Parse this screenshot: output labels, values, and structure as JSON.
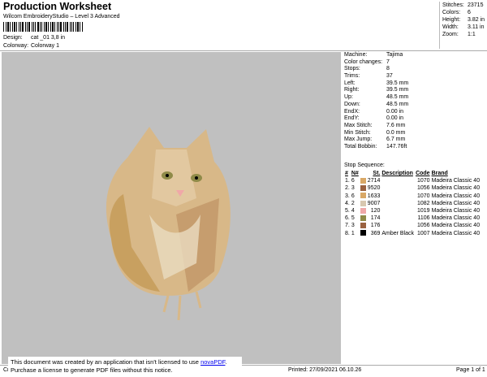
{
  "header": {
    "title": "Production Worksheet",
    "subtitle": "Wilcom EmbroideryStudio – Level 3 Advanced",
    "design_label": "Design:",
    "design_value": "cat _01 3,8 in",
    "colorway_label": "Colorway:",
    "colorway_value": "Colorway 1"
  },
  "stats": [
    {
      "k": "Stitches:",
      "v": "23715"
    },
    {
      "k": "Colors:",
      "v": "6"
    },
    {
      "k": "Height:",
      "v": "3.82 in"
    },
    {
      "k": "Width:",
      "v": "3.11 in"
    },
    {
      "k": "Zoom:",
      "v": "1:1"
    }
  ],
  "info": [
    {
      "k": "Machine:",
      "v": "Tajima"
    },
    {
      "k": "Color changes:",
      "v": "7"
    },
    {
      "k": "Stops:",
      "v": "8"
    },
    {
      "k": "Trims:",
      "v": "37"
    },
    {
      "k": "Left:",
      "v": "39.5 mm"
    },
    {
      "k": "Right:",
      "v": "39.5 mm"
    },
    {
      "k": "Up:",
      "v": "48.5 mm"
    },
    {
      "k": "Down:",
      "v": "48.5 mm"
    },
    {
      "k": "EndX:",
      "v": "0.00 in"
    },
    {
      "k": "EndY:",
      "v": "0.00 in"
    },
    {
      "k": "Max Stitch:",
      "v": "7.6 mm"
    },
    {
      "k": "Min Stitch:",
      "v": "0.0 mm"
    },
    {
      "k": "Max Jump:",
      "v": "6.7 mm"
    },
    {
      "k": "Total Bobbin:",
      "v": "147.76ft"
    }
  ],
  "sequence": {
    "title": "Stop Sequence:",
    "headers": [
      "#",
      "N#",
      "St.",
      "Description",
      "Code",
      "Brand"
    ],
    "rows": [
      {
        "i": "1.",
        "n": "6",
        "color": "#d9a866",
        "st": "2714",
        "desc": "",
        "code": "1070",
        "brand": "Madeira Classic 40"
      },
      {
        "i": "2.",
        "n": "3",
        "color": "#9a6240",
        "st": "9520",
        "desc": "",
        "code": "1056",
        "brand": "Madeira Classic 40"
      },
      {
        "i": "3.",
        "n": "6",
        "color": "#d9a866",
        "st": "1633",
        "desc": "",
        "code": "1070",
        "brand": "Madeira Classic 40"
      },
      {
        "i": "4.",
        "n": "2",
        "color": "#d8c8b0",
        "st": "9007",
        "desc": "",
        "code": "1082",
        "brand": "Madeira Classic 40"
      },
      {
        "i": "5.",
        "n": "4",
        "color": "#f0a8a8",
        "st": "120",
        "desc": "",
        "code": "1019",
        "brand": "Madeira Classic 40"
      },
      {
        "i": "6.",
        "n": "5",
        "color": "#8f8a48",
        "st": "174",
        "desc": "",
        "code": "1106",
        "brand": "Madeira Classic 40"
      },
      {
        "i": "7.",
        "n": "3",
        "color": "#9a6240",
        "st": "176",
        "desc": "",
        "code": "1056",
        "brand": "Madeira Classic 40"
      },
      {
        "i": "8.",
        "n": "1",
        "color": "#000000",
        "st": "369",
        "desc": "Amber Black",
        "code": "1007",
        "brand": "Madeira Classic 40"
      }
    ]
  },
  "footer": {
    "left": "Cr",
    "printed": "Printed: 27/09/2021 06.10.26",
    "page": "Page 1 of 1"
  },
  "notice": {
    "line1": "This document was created by an application that isn't licensed to use ",
    "link": "novaPDF",
    "line1_end": ".",
    "line2": "Purchase a license to generate PDF files without this notice."
  }
}
